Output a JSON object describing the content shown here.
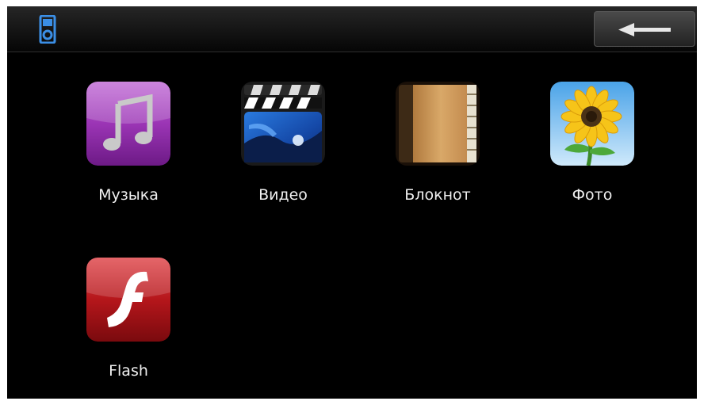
{
  "header": {
    "device_icon": "media-player-icon",
    "back_icon": "arrow-left-icon",
    "accent": "#3b8fe6"
  },
  "apps": [
    {
      "label": "Музыка",
      "icon": "music-note-icon",
      "color": "#8f2fa8"
    },
    {
      "label": "Видео",
      "icon": "clapperboard-icon",
      "color": "#1d5ab0"
    },
    {
      "label": "Блокнот",
      "icon": "notebook-icon",
      "color": "#c9935a"
    },
    {
      "label": "Фото",
      "icon": "sunflower-icon",
      "color": "#f2c21a"
    },
    {
      "label": "Flash",
      "icon": "flash-icon",
      "color": "#b5161b"
    }
  ]
}
